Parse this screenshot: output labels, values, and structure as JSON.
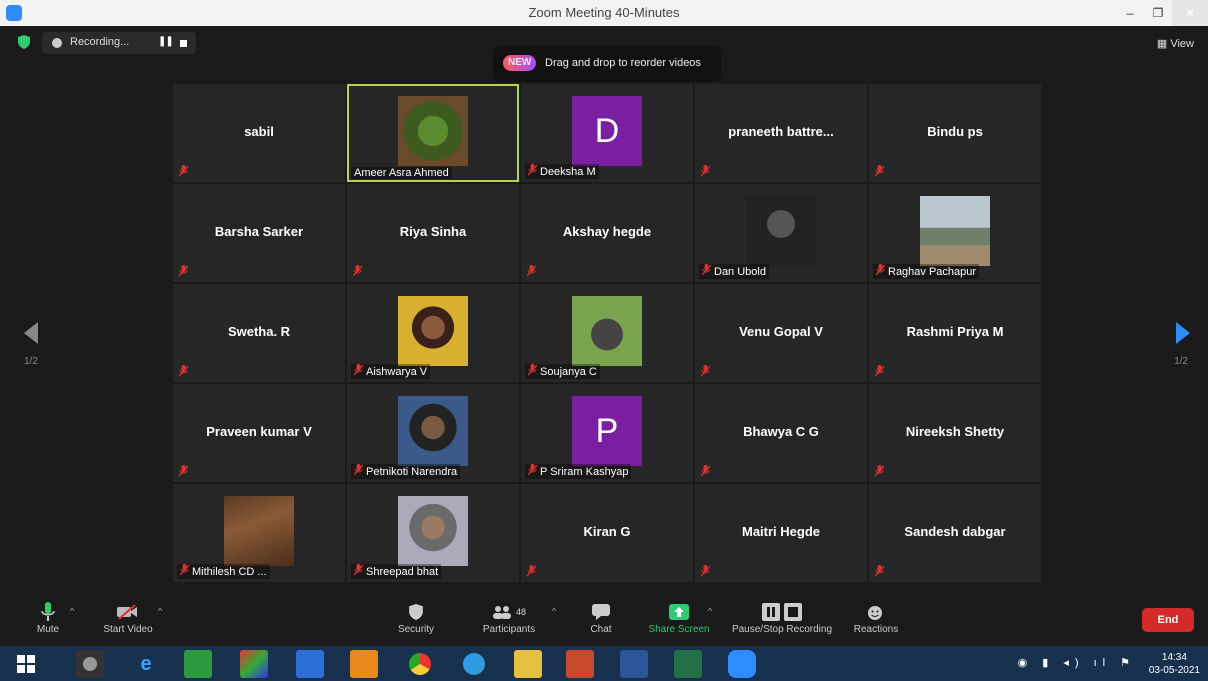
{
  "window": {
    "title": "Zoom Meeting 40-Minutes",
    "minimize": "–",
    "maximize": "❐",
    "close": "✕"
  },
  "topbar": {
    "recording_label": "Recording...",
    "pause_icon": "❚❚",
    "view_label": "View",
    "view_icon": "▦"
  },
  "tooltip": {
    "badge": "NEW",
    "text": "Drag and drop to reorder videos"
  },
  "pager": {
    "left": "1/2",
    "right": "1/2"
  },
  "participants": [
    {
      "name": "sabil",
      "kind": "name"
    },
    {
      "name": "Ameer Asra Ahmed",
      "kind": "photo",
      "photo": "plant",
      "active": true
    },
    {
      "name": "Deeksha M",
      "kind": "avatar",
      "initial": "D"
    },
    {
      "name": "praneeth battre...",
      "kind": "name"
    },
    {
      "name": "Bindu ps",
      "kind": "name"
    },
    {
      "name": "Barsha Sarker",
      "kind": "name"
    },
    {
      "name": "Riya Sinha",
      "kind": "name"
    },
    {
      "name": "Akshay hegde",
      "kind": "name"
    },
    {
      "name": "Dan Ubold",
      "kind": "photo",
      "photo": "dark-portrait"
    },
    {
      "name": "Raghav Pachapur",
      "kind": "photo",
      "photo": "mountain"
    },
    {
      "name": "Swetha. R",
      "kind": "name"
    },
    {
      "name": "Aishwarya V",
      "kind": "photo",
      "photo": "woman-yellow"
    },
    {
      "name": "Soujanya C",
      "kind": "photo",
      "photo": "cat"
    },
    {
      "name": "Venu Gopal V",
      "kind": "name"
    },
    {
      "name": "Rashmi Priya M",
      "kind": "name"
    },
    {
      "name": "Praveen kumar V",
      "kind": "name"
    },
    {
      "name": "Petnikoti Narendra",
      "kind": "photo",
      "photo": "man-blue"
    },
    {
      "name": "P Sriram Kashyap",
      "kind": "avatar",
      "initial": "P"
    },
    {
      "name": "Bhawya C G",
      "kind": "name"
    },
    {
      "name": "Nireeksh Shetty",
      "kind": "name"
    },
    {
      "name": "Mithilesh CD ...",
      "kind": "photo",
      "photo": "wood"
    },
    {
      "name": "Shreepad bhat",
      "kind": "photo",
      "photo": "man-mask"
    },
    {
      "name": "Kiran G",
      "kind": "name"
    },
    {
      "name": "Maitri Hegde",
      "kind": "name"
    },
    {
      "name": "Sandesh dabgar",
      "kind": "name"
    }
  ],
  "toolbar": {
    "mute": "Mute",
    "start_video": "Start Video",
    "security": "Security",
    "participants": "Participants",
    "participants_count": "48",
    "chat": "Chat",
    "share_screen": "Share Screen",
    "recording": "Pause/Stop Recording",
    "reactions": "Reactions",
    "end": "End",
    "caret": "^"
  },
  "taskbar": {
    "time": "14:34",
    "date": "03-05-2021"
  },
  "colors": {
    "accent": "#2d8cff",
    "active_border": "#b6d64a",
    "avatar": "#7b1fa2",
    "end": "#d52a2a",
    "share": "#2ecc71"
  }
}
